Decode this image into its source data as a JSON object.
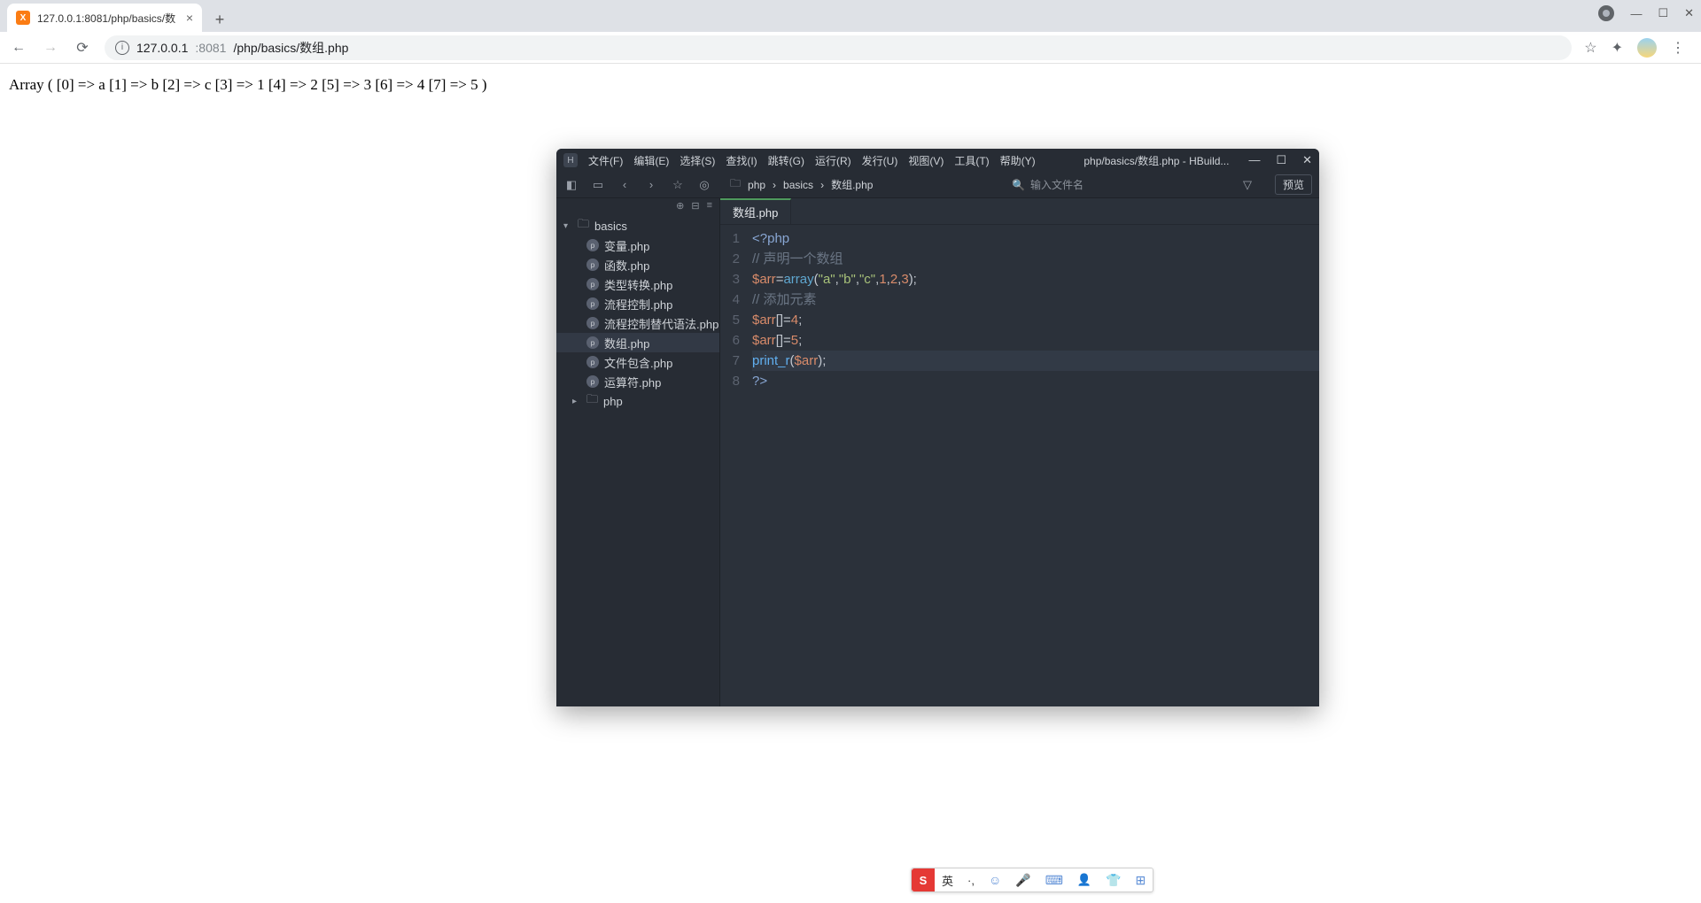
{
  "browser": {
    "tab_title": "127.0.0.1:8081/php/basics/数",
    "url_host": "127.0.0.1",
    "url_port": ":8081",
    "url_path": "/php/basics/数组.php"
  },
  "page": {
    "output": "Array ( [0] => a [1] => b [2] => c [3] => 1 [4] => 2 [5] => 3 [6] => 4 [7] => 5 )"
  },
  "editor": {
    "menus": [
      "文件(F)",
      "编辑(E)",
      "选择(S)",
      "查找(I)",
      "跳转(G)",
      "运行(R)",
      "发行(U)",
      "视图(V)",
      "工具(T)",
      "帮助(Y)"
    ],
    "title_path": "php/basics/数组.php - HBuild...",
    "breadcrumb": [
      "php",
      "basics",
      "数组.php"
    ],
    "search_placeholder": "输入文件名",
    "preview_label": "预览",
    "tree": {
      "root": "basics",
      "files": [
        "变量.php",
        "函数.php",
        "类型转换.php",
        "流程控制.php",
        "流程控制替代语法.php",
        "数组.php",
        "文件包含.php",
        "运算符.php"
      ],
      "active": "数组.php",
      "sibling_folder": "php"
    },
    "file_tab": "数组.php",
    "code": {
      "lines": [
        {
          "n": 1,
          "segments": [
            {
              "t": "<?",
              "c": "tk-tag"
            },
            {
              "t": "php",
              "c": "tk-tag"
            }
          ]
        },
        {
          "n": 2,
          "segments": [
            {
              "t": "// 声明一个数组",
              "c": "tk-comment"
            }
          ]
        },
        {
          "n": 3,
          "segments": [
            {
              "t": "$arr",
              "c": "tk-var"
            },
            {
              "t": "=",
              "c": "tk-op"
            },
            {
              "t": "array",
              "c": "tk-kw"
            },
            {
              "t": "(",
              "c": "tk-punc"
            },
            {
              "t": "\"a\"",
              "c": "tk-str"
            },
            {
              "t": ",",
              "c": "tk-punc"
            },
            {
              "t": "\"b\"",
              "c": "tk-str"
            },
            {
              "t": ",",
              "c": "tk-punc"
            },
            {
              "t": "\"c\"",
              "c": "tk-str"
            },
            {
              "t": ",",
              "c": "tk-punc"
            },
            {
              "t": "1",
              "c": "tk-num"
            },
            {
              "t": ",",
              "c": "tk-punc"
            },
            {
              "t": "2",
              "c": "tk-num"
            },
            {
              "t": ",",
              "c": "tk-punc"
            },
            {
              "t": "3",
              "c": "tk-num"
            },
            {
              "t": ");",
              "c": "tk-punc"
            }
          ]
        },
        {
          "n": 4,
          "segments": [
            {
              "t": "// 添加元素",
              "c": "tk-comment"
            }
          ]
        },
        {
          "n": 5,
          "segments": [
            {
              "t": "$arr",
              "c": "tk-var"
            },
            {
              "t": "[]=",
              "c": "tk-op"
            },
            {
              "t": "4",
              "c": "tk-num"
            },
            {
              "t": ";",
              "c": "tk-punc"
            }
          ]
        },
        {
          "n": 6,
          "segments": [
            {
              "t": "$arr",
              "c": "tk-var"
            },
            {
              "t": "[]=",
              "c": "tk-op"
            },
            {
              "t": "5",
              "c": "tk-num"
            },
            {
              "t": ";",
              "c": "tk-punc"
            }
          ]
        },
        {
          "n": 7,
          "hl": true,
          "segments": [
            {
              "t": "print_r",
              "c": "tk-func"
            },
            {
              "t": "(",
              "c": "tk-punc"
            },
            {
              "t": "$arr",
              "c": "tk-var"
            },
            {
              "t": ");",
              "c": "tk-punc"
            }
          ]
        },
        {
          "n": 8,
          "segments": [
            {
              "t": "?>",
              "c": "tk-tag"
            }
          ]
        }
      ]
    }
  },
  "ime": {
    "logo": "S",
    "lang": "英"
  }
}
